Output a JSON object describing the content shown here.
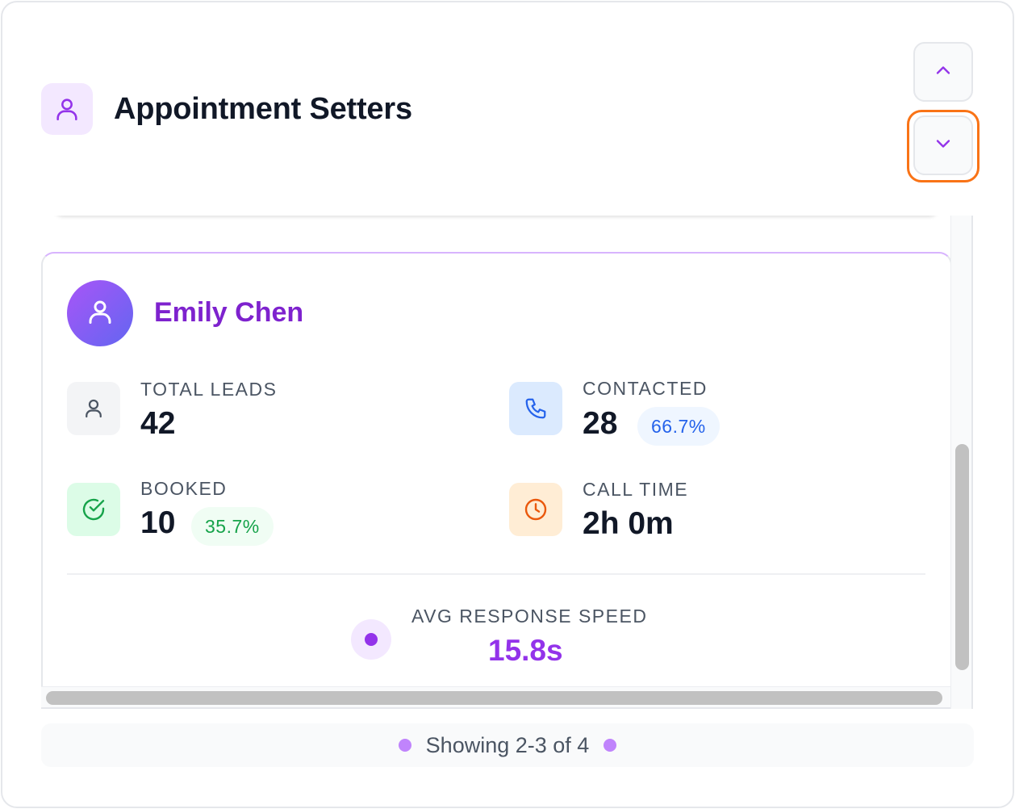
{
  "header": {
    "title": "Appointment Setters",
    "icon": "user-icon"
  },
  "nav": {
    "up_icon": "chevron-up-icon",
    "down_icon": "chevron-down-icon",
    "focused": "down"
  },
  "card": {
    "name": "Emily Chen",
    "avatar_icon": "user-icon",
    "stats": {
      "total_leads": {
        "label": "TOTAL LEADS",
        "value": "42",
        "icon": "user-icon"
      },
      "contacted": {
        "label": "CONTACTED",
        "value": "28",
        "badge": "66.7%",
        "icon": "phone-icon"
      },
      "booked": {
        "label": "BOOKED",
        "value": "10",
        "badge": "35.7%",
        "icon": "check-circle-icon"
      },
      "call_time": {
        "label": "CALL TIME",
        "value": "2h 0m",
        "icon": "clock-icon"
      }
    },
    "avg_response": {
      "label": "AVG RESPONSE SPEED",
      "value": "15.8s"
    }
  },
  "footer": {
    "text": "Showing 2-3 of 4"
  },
  "colors": {
    "accent": "#9333ea",
    "name": "#7e22ce",
    "contacted_badge_bg": "#eff6ff",
    "contacted_badge_text": "#2563eb",
    "booked_badge_bg": "#f0fdf4",
    "booked_badge_text": "#16a34a",
    "focus_ring": "#f97316"
  }
}
